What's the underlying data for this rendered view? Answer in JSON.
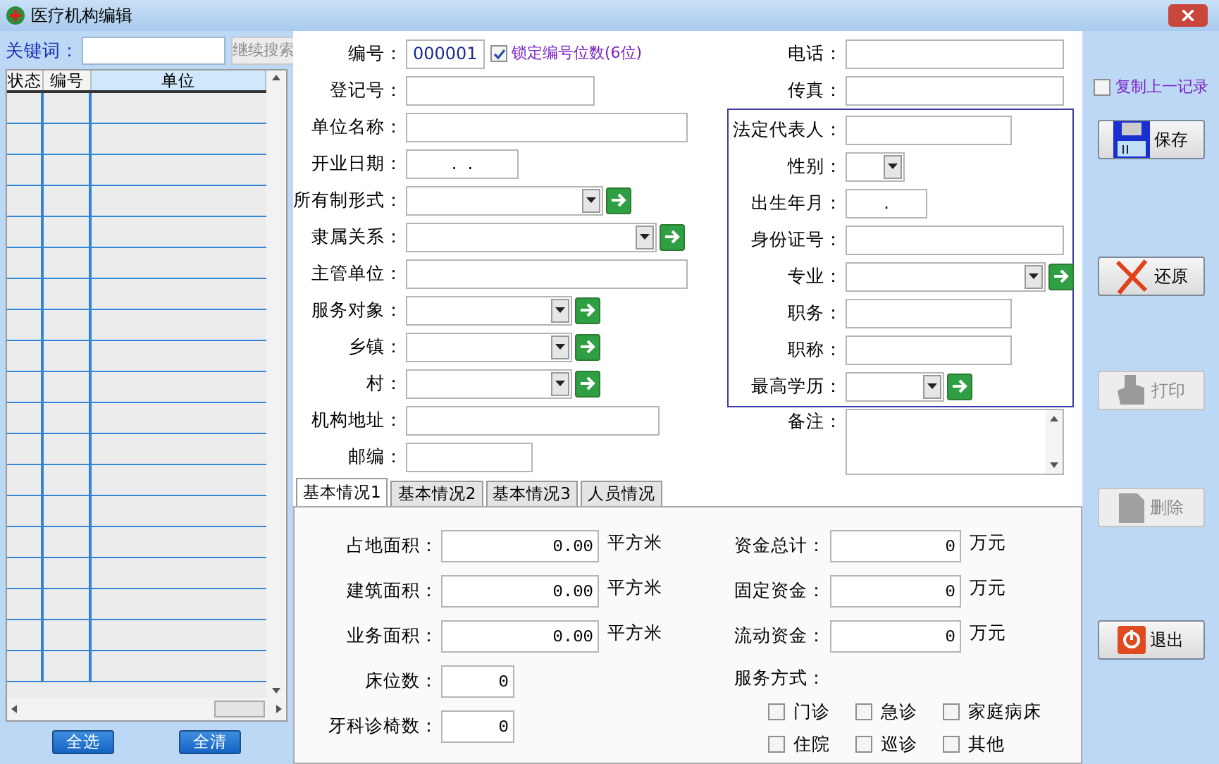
{
  "window": {
    "title": "医疗机构编辑"
  },
  "search": {
    "label": "关键词：",
    "button": {
      "label": "继续搜索",
      "disabled": true
    }
  },
  "list": {
    "columns": [
      "状态",
      "编号",
      "单位"
    ],
    "buttons": [
      "全选",
      "全清"
    ]
  },
  "form_left": [
    {
      "label": "编号：",
      "kind": "text",
      "value": "000001",
      "lock": {
        "label": "锁定编号位数(6位)",
        "checked": true
      }
    },
    {
      "label": "登记号：",
      "kind": "text"
    },
    {
      "label": "单位名称：",
      "kind": "text"
    },
    {
      "label": "开业日期：",
      "kind": "date",
      "value": ".  ."
    },
    {
      "label": "所有制形式：",
      "kind": "combo_go"
    },
    {
      "label": "隶属关系：",
      "kind": "combo_go"
    },
    {
      "label": "主管单位：",
      "kind": "text"
    },
    {
      "label": "服务对象：",
      "kind": "combo_go"
    },
    {
      "label": "乡镇：",
      "kind": "combo_go"
    },
    {
      "label": "村：",
      "kind": "combo_go"
    },
    {
      "label": "机构地址：",
      "kind": "text"
    },
    {
      "label": "邮编：",
      "kind": "text"
    }
  ],
  "form_right": [
    {
      "label": "电话：",
      "kind": "text"
    },
    {
      "label": "传真：",
      "kind": "text"
    }
  ],
  "person_group": [
    {
      "label": "法定代表人：",
      "kind": "text"
    },
    {
      "label": "性别：",
      "kind": "combo"
    },
    {
      "label": "出生年月：",
      "kind": "date",
      "value": "."
    },
    {
      "label": "身份证号：",
      "kind": "text"
    },
    {
      "label": "专业：",
      "kind": "combo_go"
    },
    {
      "label": "职务：",
      "kind": "text"
    },
    {
      "label": "职称：",
      "kind": "text"
    },
    {
      "label": "最高学历：",
      "kind": "combo_go"
    }
  ],
  "remark": {
    "label": "备注："
  },
  "copy_last": {
    "label": "复制上一记录",
    "checked": false
  },
  "actions": [
    {
      "kind": "save",
      "label": "保存",
      "disabled": false
    },
    {
      "kind": "undo",
      "label": "还原",
      "disabled": false
    },
    {
      "kind": "print",
      "label": "打印",
      "disabled": true
    },
    {
      "kind": "delete",
      "label": "删除",
      "disabled": true
    },
    {
      "kind": "exit",
      "label": "退出",
      "disabled": false
    }
  ],
  "tabs": [
    {
      "label": "基本情况1",
      "selected": true
    },
    {
      "label": "基本情况2",
      "selected": false
    },
    {
      "label": "基本情况3",
      "selected": false
    },
    {
      "label": "人员情况",
      "selected": false
    }
  ],
  "basic": {
    "left": [
      {
        "label": "占地面积：",
        "value": "0.00",
        "unit": "平方米"
      },
      {
        "label": "建筑面积：",
        "value": "0.00",
        "unit": "平方米"
      },
      {
        "label": "业务面积：",
        "value": "0.00",
        "unit": "平方米"
      },
      {
        "label": "床位数：",
        "value": "0"
      },
      {
        "label": "牙科诊椅数：",
        "value": "0"
      }
    ],
    "right": [
      {
        "label": "资金总计：",
        "value": "0",
        "unit": "万元"
      },
      {
        "label": "固定资金：",
        "value": "0",
        "unit": "万元"
      },
      {
        "label": "流动资金：",
        "value": "0",
        "unit": "万元"
      }
    ],
    "service": {
      "label": "服务方式：",
      "options": [
        {
          "label": "门诊",
          "checked": false
        },
        {
          "label": "急诊",
          "checked": false
        },
        {
          "label": "家庭病床",
          "checked": false
        },
        {
          "label": "住院",
          "checked": false
        },
        {
          "label": "巡诊",
          "checked": false
        },
        {
          "label": "其他",
          "checked": false
        }
      ]
    }
  }
}
